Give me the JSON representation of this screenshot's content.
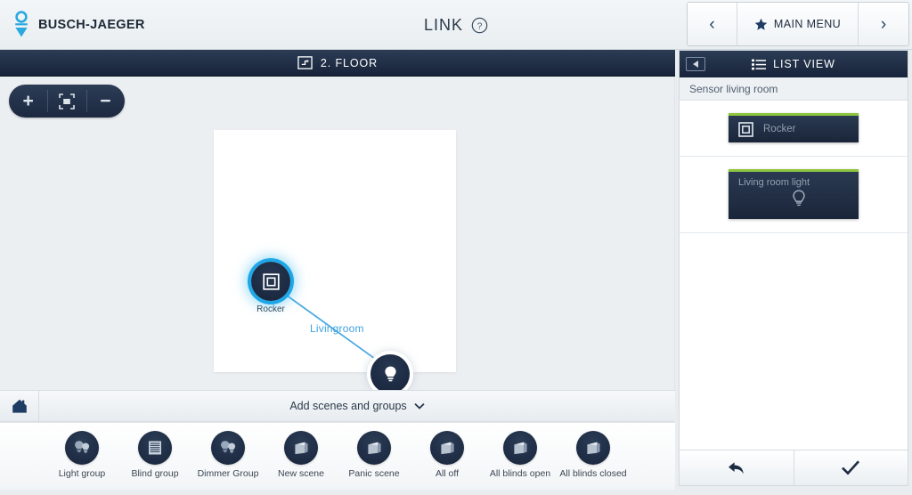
{
  "header": {
    "brand": "BUSCH-JAEGER",
    "brand_icon": "busch-jaeger-logo",
    "title": "LINK",
    "help_icon": "help-circle-icon",
    "nav": {
      "prev_icon": "chevron-left-icon",
      "next_icon": "chevron-right-icon",
      "main_menu_label": "MAIN MENU",
      "star_icon": "star-icon"
    }
  },
  "floorbar": {
    "icon": "floorplan-icon",
    "label": "2. FLOOR"
  },
  "zoom_controls": {
    "zoom_in_icon": "plus-icon",
    "fit_icon": "fit-to-screen-icon",
    "zoom_out_icon": "minus-icon"
  },
  "canvas": {
    "nodes": [
      {
        "id": "rocker",
        "label": "Rocker",
        "icon": "rocker-switch-icon",
        "selected": true
      },
      {
        "id": "living-room-light",
        "label": "Living room light",
        "icon": "light-bulb-icon",
        "selected": false
      }
    ],
    "link": {
      "label": "Livingroom",
      "color": "#4aa9e0"
    }
  },
  "addbar": {
    "home_icon": "home-icon",
    "label": "Add scenes and groups",
    "caret_icon": "chevron-down-icon"
  },
  "tray": {
    "items": [
      {
        "label": "Light group",
        "icon": "light-group-icon"
      },
      {
        "label": "Blind group",
        "icon": "blind-group-icon"
      },
      {
        "label": "Dimmer Group",
        "icon": "dimmer-group-icon"
      },
      {
        "label": "New scene",
        "icon": "scene-icon"
      },
      {
        "label": "Panic scene",
        "icon": "scene-icon"
      },
      {
        "label": "All off",
        "icon": "scene-icon"
      },
      {
        "label": "All blinds open",
        "icon": "scene-icon"
      },
      {
        "label": "All blinds closed",
        "icon": "scene-icon"
      }
    ]
  },
  "right_panel": {
    "collapse_icon": "collapse-left-icon",
    "list_icon": "list-icon",
    "title": "LIST VIEW",
    "group_label": "Sensor living room",
    "cards": [
      {
        "id": "rocker-card",
        "label": "Rocker",
        "icon": "rocker-switch-icon",
        "accent": "#8ec63f"
      },
      {
        "id": "light-card",
        "label": "Living room light",
        "icon": "light-bulb-outline-icon",
        "accent": "#8ec63f"
      }
    ],
    "footer": {
      "back_icon": "back-arrow-icon",
      "confirm_icon": "checkmark-icon"
    }
  },
  "colors": {
    "accent_green": "#8ec63f",
    "accent_cyan": "#1ea7e8",
    "dark_navy": "#1a2539",
    "page_bg": "#e9edf0"
  }
}
